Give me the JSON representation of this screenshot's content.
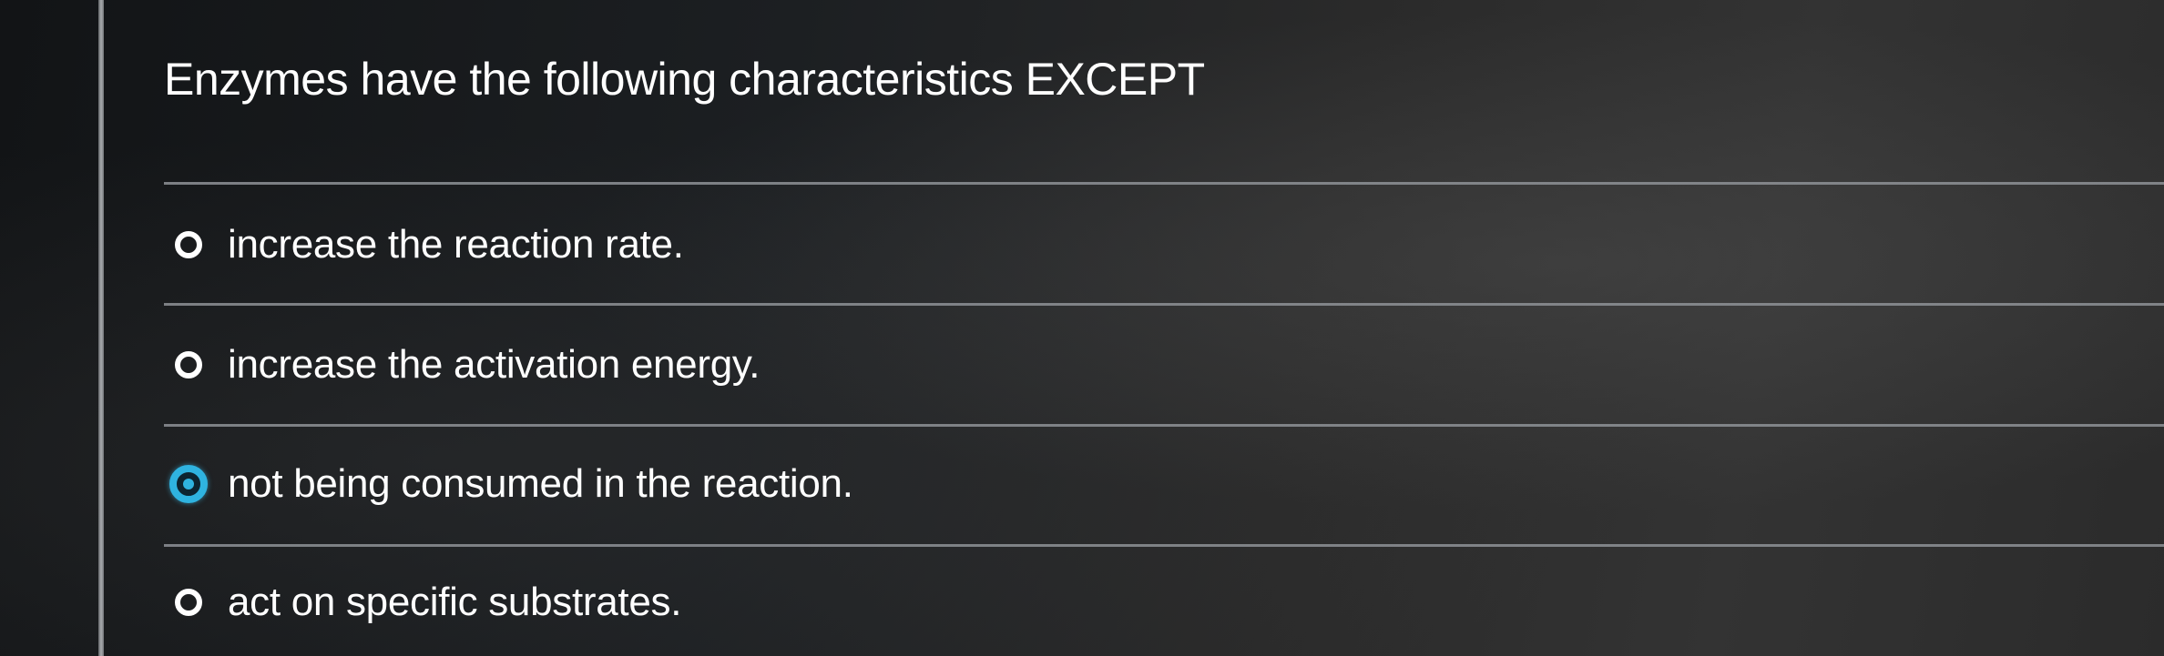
{
  "question": {
    "text": "Enzymes have the following characteristics EXCEPT"
  },
  "options": [
    {
      "label": "increase the reaction rate.",
      "selected": false
    },
    {
      "label": "increase the activation energy.",
      "selected": false
    },
    {
      "label": "not being consumed in the reaction.",
      "selected": true
    },
    {
      "label": "act on specific substrates.",
      "selected": false
    }
  ],
  "colors": {
    "text": "#ffffff",
    "selected_accent": "#2fb3e0",
    "divider": "#8e9296"
  }
}
